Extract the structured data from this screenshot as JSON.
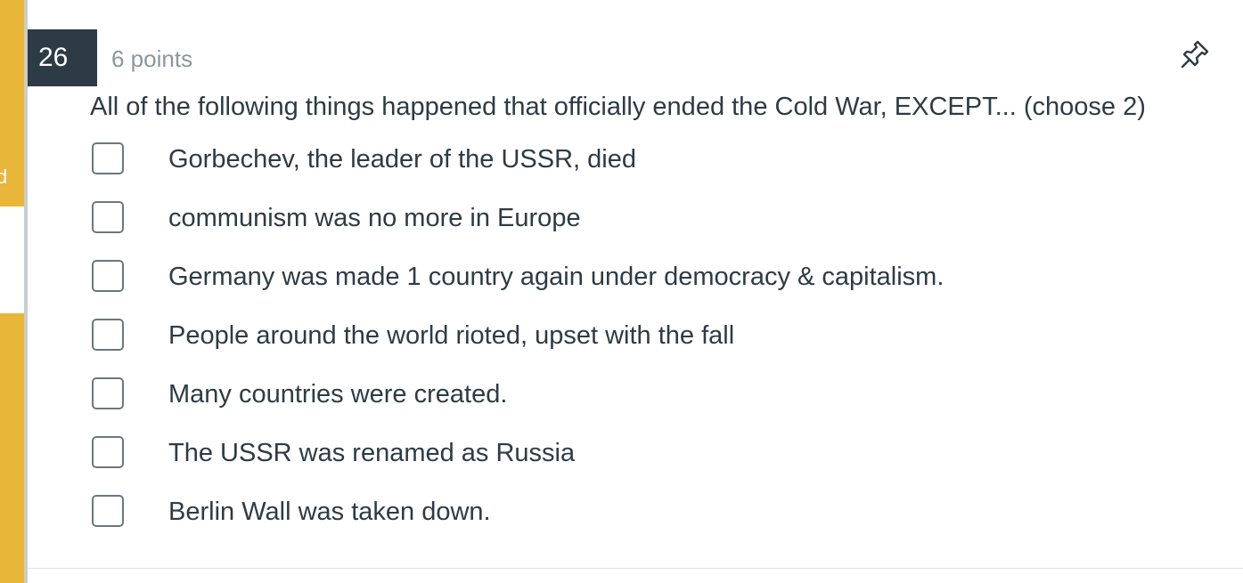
{
  "sidebar": {
    "partial_text": "d"
  },
  "question": {
    "number": "26",
    "points": "6 points",
    "text": "All of the following things happened that officially ended the Cold War, EXCEPT... (choose 2)",
    "pin_icon": "pin-icon",
    "answers": [
      {
        "label": "Gorbechev, the leader of the USSR, died",
        "checked": false
      },
      {
        "label": "communism was no more in Europe",
        "checked": false
      },
      {
        "label": "Germany was made 1 country again under democracy & capitalism.",
        "checked": false
      },
      {
        "label": "People around the world rioted, upset with the fall",
        "checked": false
      },
      {
        "label": "Many countries were created.",
        "checked": false
      },
      {
        "label": "The USSR was renamed as Russia",
        "checked": false
      },
      {
        "label": "Berlin Wall was taken down.",
        "checked": false
      }
    ]
  },
  "colors": {
    "sidebar_accent": "#e8b73a",
    "number_badge": "#2d3b45",
    "text": "#2d3b45",
    "points_text": "#8b969e"
  }
}
